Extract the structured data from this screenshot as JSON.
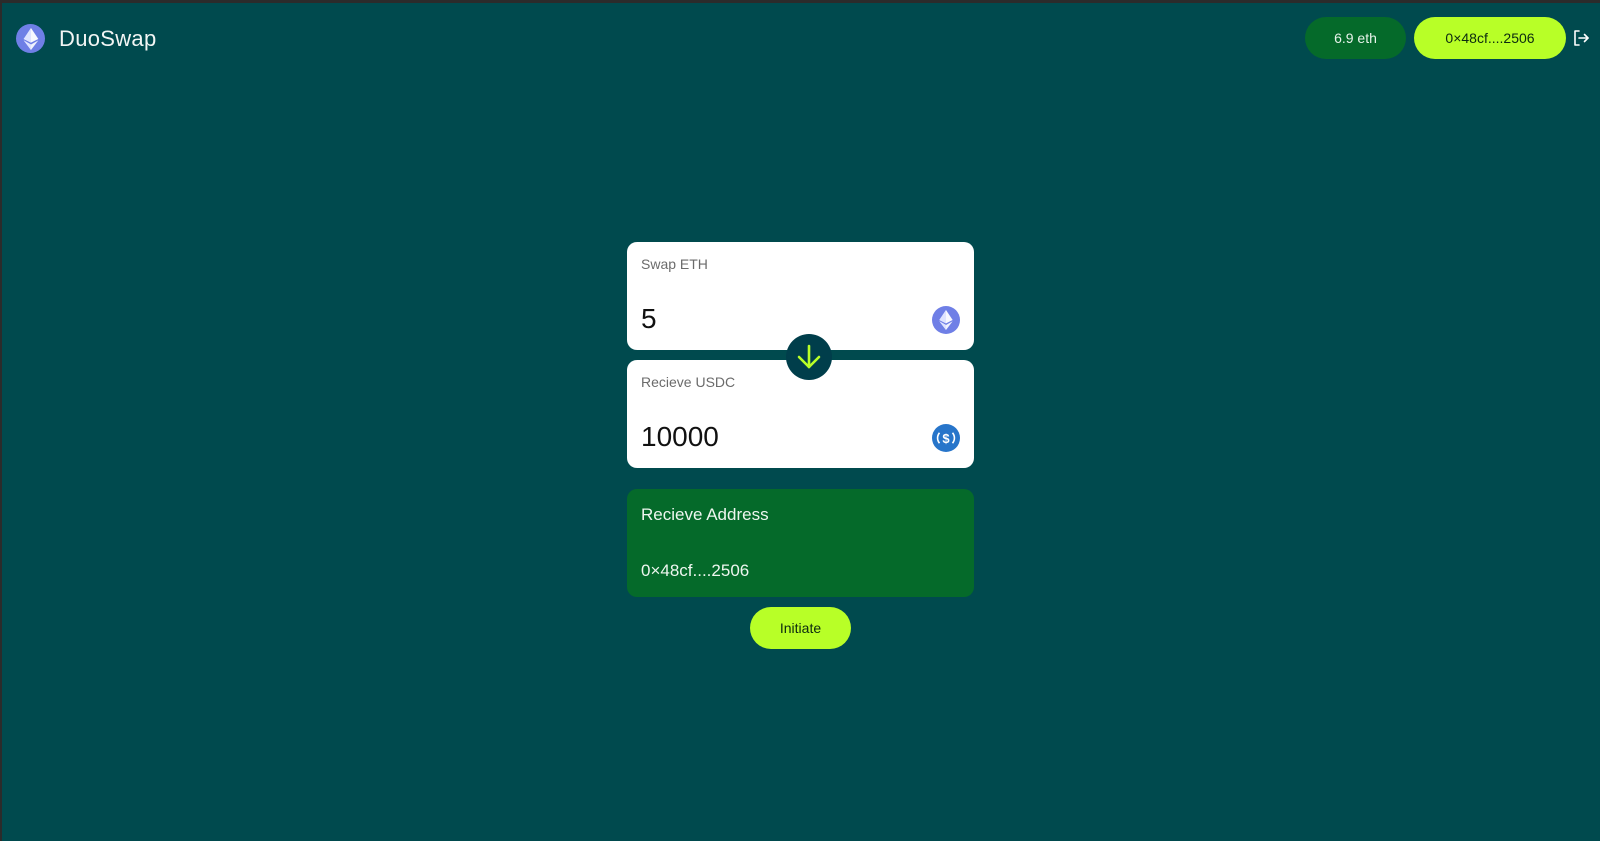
{
  "app": {
    "name": "DuoSwap",
    "logo_icon": "ethereum-icon"
  },
  "header": {
    "balance": "6.9 eth",
    "wallet_address": "0×48cf....2506",
    "logout_icon": "logout-icon"
  },
  "swap": {
    "from": {
      "label": "Swap ETH",
      "value": "5",
      "token_icon": "ethereum-icon"
    },
    "to": {
      "label": "Recieve USDC",
      "value": "10000",
      "token_icon": "usdc-icon"
    },
    "switch_icon": "arrow-down-icon"
  },
  "receive_address": {
    "title": "Recieve Address",
    "value": "0×48cf....2506"
  },
  "actions": {
    "initiate_label": "Initiate"
  },
  "colors": {
    "background": "#004a4e",
    "accent_lime": "#b8ff27",
    "dark_green": "#056a2a",
    "eth_purple": "#6f7fe6",
    "usdc_blue": "#2775ca"
  }
}
